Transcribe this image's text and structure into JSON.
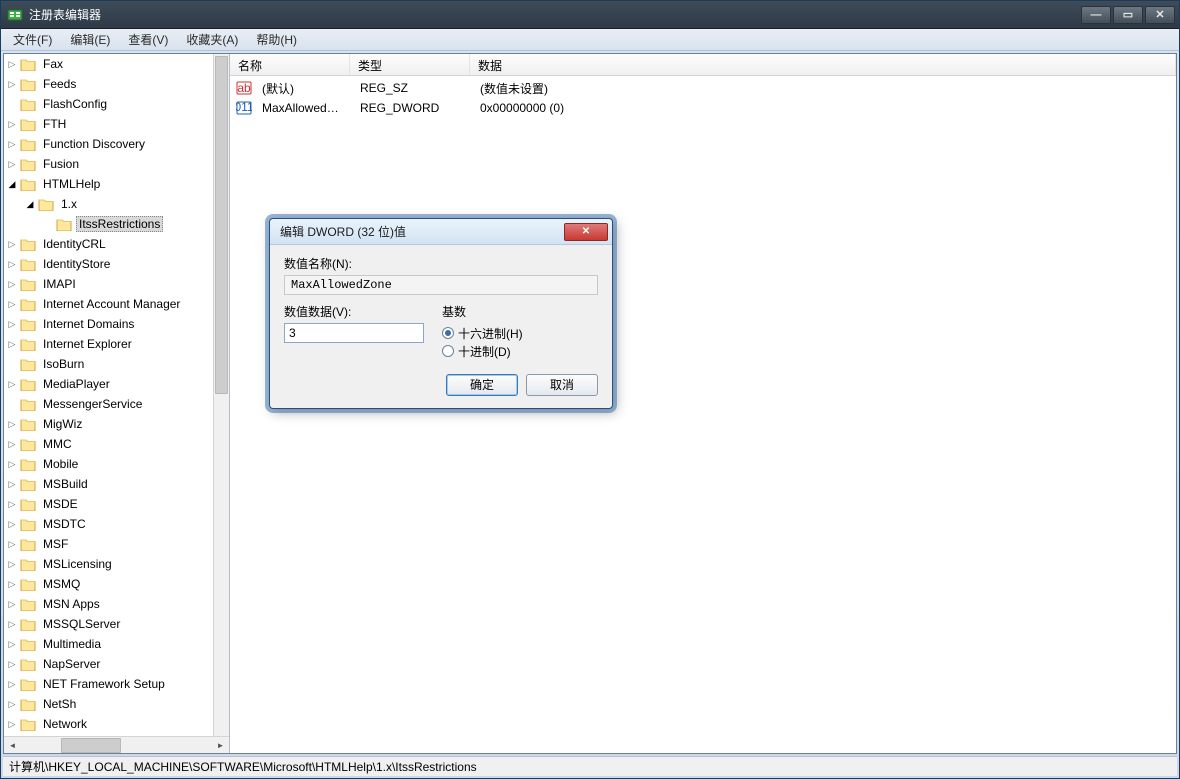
{
  "window": {
    "title": "注册表编辑器"
  },
  "menu": {
    "file": "文件(F)",
    "edit": "编辑(E)",
    "view": "查看(V)",
    "favorites": "收藏夹(A)",
    "help": "帮助(H)"
  },
  "tree": {
    "items": [
      {
        "label": "Fax",
        "indent": 0,
        "expandable": true,
        "expanded": false
      },
      {
        "label": "Feeds",
        "indent": 0,
        "expandable": true,
        "expanded": false
      },
      {
        "label": "FlashConfig",
        "indent": 0,
        "expandable": false
      },
      {
        "label": "FTH",
        "indent": 0,
        "expandable": true,
        "expanded": false
      },
      {
        "label": "Function Discovery",
        "indent": 0,
        "expandable": true,
        "expanded": false
      },
      {
        "label": "Fusion",
        "indent": 0,
        "expandable": true,
        "expanded": false
      },
      {
        "label": "HTMLHelp",
        "indent": 0,
        "expandable": true,
        "expanded": true
      },
      {
        "label": "1.x",
        "indent": 1,
        "expandable": true,
        "expanded": true
      },
      {
        "label": "ItssRestrictions",
        "indent": 2,
        "expandable": false,
        "selected": true
      },
      {
        "label": "IdentityCRL",
        "indent": 0,
        "expandable": true,
        "expanded": false
      },
      {
        "label": "IdentityStore",
        "indent": 0,
        "expandable": true,
        "expanded": false
      },
      {
        "label": "IMAPI",
        "indent": 0,
        "expandable": true,
        "expanded": false
      },
      {
        "label": "Internet Account Manager",
        "indent": 0,
        "expandable": true,
        "expanded": false
      },
      {
        "label": "Internet Domains",
        "indent": 0,
        "expandable": true,
        "expanded": false
      },
      {
        "label": "Internet Explorer",
        "indent": 0,
        "expandable": true,
        "expanded": false
      },
      {
        "label": "IsoBurn",
        "indent": 0,
        "expandable": false
      },
      {
        "label": "MediaPlayer",
        "indent": 0,
        "expandable": true,
        "expanded": false
      },
      {
        "label": "MessengerService",
        "indent": 0,
        "expandable": false
      },
      {
        "label": "MigWiz",
        "indent": 0,
        "expandable": true,
        "expanded": false
      },
      {
        "label": "MMC",
        "indent": 0,
        "expandable": true,
        "expanded": false
      },
      {
        "label": "Mobile",
        "indent": 0,
        "expandable": true,
        "expanded": false
      },
      {
        "label": "MSBuild",
        "indent": 0,
        "expandable": true,
        "expanded": false
      },
      {
        "label": "MSDE",
        "indent": 0,
        "expandable": true,
        "expanded": false
      },
      {
        "label": "MSDTC",
        "indent": 0,
        "expandable": true,
        "expanded": false
      },
      {
        "label": "MSF",
        "indent": 0,
        "expandable": true,
        "expanded": false
      },
      {
        "label": "MSLicensing",
        "indent": 0,
        "expandable": true,
        "expanded": false
      },
      {
        "label": "MSMQ",
        "indent": 0,
        "expandable": true,
        "expanded": false
      },
      {
        "label": "MSN Apps",
        "indent": 0,
        "expandable": true,
        "expanded": false
      },
      {
        "label": "MSSQLServer",
        "indent": 0,
        "expandable": true,
        "expanded": false
      },
      {
        "label": "Multimedia",
        "indent": 0,
        "expandable": true,
        "expanded": false
      },
      {
        "label": "NapServer",
        "indent": 0,
        "expandable": true,
        "expanded": false
      },
      {
        "label": "NET Framework Setup",
        "indent": 0,
        "expandable": true,
        "expanded": false
      },
      {
        "label": "NetSh",
        "indent": 0,
        "expandable": true,
        "expanded": false
      },
      {
        "label": "Network",
        "indent": 0,
        "expandable": true,
        "expanded": false
      }
    ]
  },
  "list": {
    "columns": {
      "name": "名称",
      "type": "类型",
      "data": "数据"
    },
    "rows": [
      {
        "icon": "string",
        "name": "(默认)",
        "type": "REG_SZ",
        "data": "(数值未设置)"
      },
      {
        "icon": "dword",
        "name": "MaxAllowedZo...",
        "type": "REG_DWORD",
        "data": "0x00000000 (0)"
      }
    ]
  },
  "statusbar": {
    "path": "计算机\\HKEY_LOCAL_MACHINE\\SOFTWARE\\Microsoft\\HTMLHelp\\1.x\\ItssRestrictions"
  },
  "dialog": {
    "title": "编辑 DWORD (32 位)值",
    "name_label": "数值名称(N):",
    "name_value": "MaxAllowedZone",
    "data_label": "数值数据(V):",
    "data_value": "3",
    "base_label": "基数",
    "radio_hex": "十六进制(H)",
    "radio_dec": "十进制(D)",
    "ok": "确定",
    "cancel": "取消"
  }
}
